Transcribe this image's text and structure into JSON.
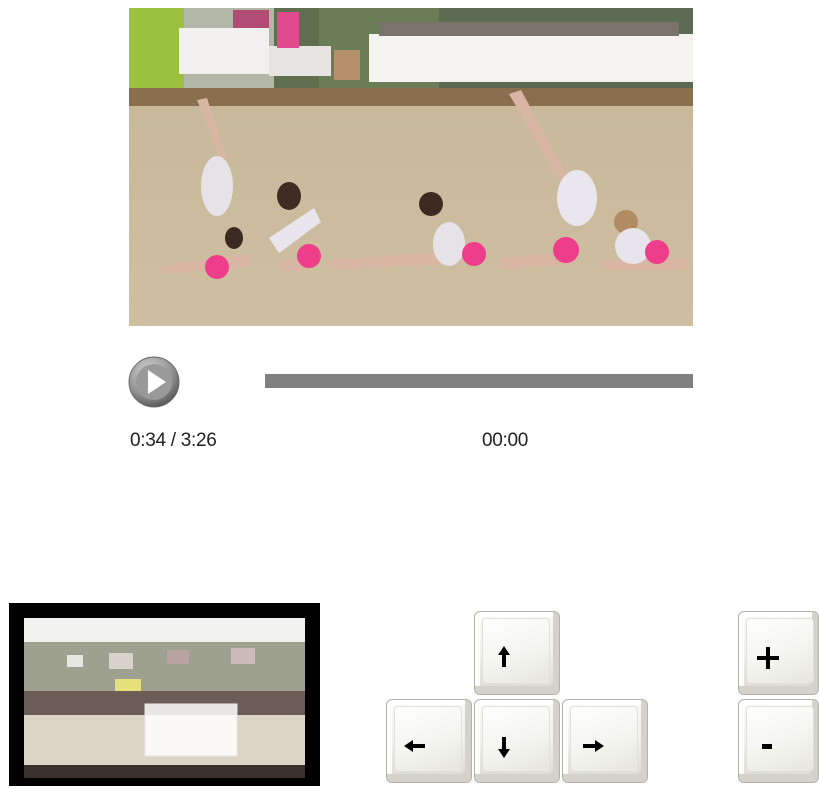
{
  "player": {
    "time_elapsed": "0:34 / 3:26",
    "time_marker": "00:00",
    "progress_fraction": 0.0,
    "play_icon": "play-icon"
  },
  "controls": {
    "pan_keys": [
      "up",
      "left",
      "down",
      "right"
    ],
    "zoom_keys": [
      "plus",
      "minus"
    ]
  },
  "colors": {
    "progress_track": "#808080",
    "floor": "#c9b99c",
    "ball": "#ee3d8a",
    "overview_frame": "#000000"
  }
}
